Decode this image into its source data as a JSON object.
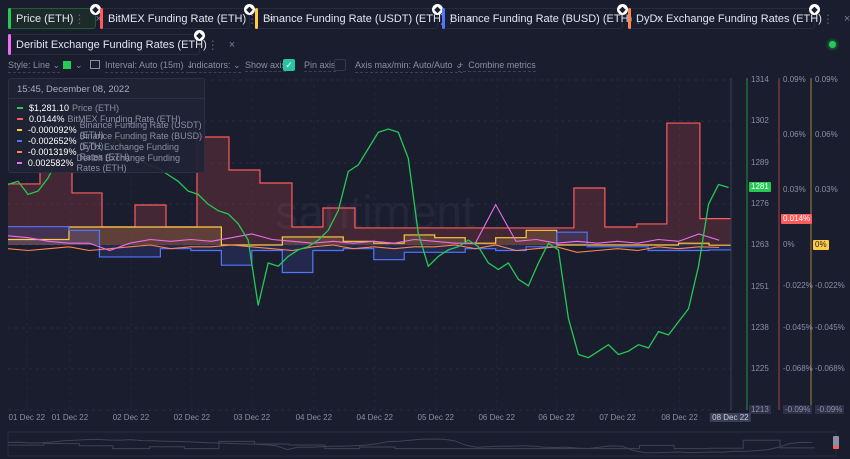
{
  "tabs": [
    {
      "label": "Price (ETH)",
      "color": "#26c953"
    },
    {
      "label": "BitMEX Funding Rate (ETH)",
      "color": "#ff5b5b"
    },
    {
      "label": "Binance Funding Rate (USDT) (ETH)",
      "color": "#ffcb47"
    },
    {
      "label": "Binance Funding Rate (BUSD) (ETH)",
      "color": "#5275ff"
    },
    {
      "label": "DyDx Exchange Funding Rates (ETH)",
      "color": "#ff8450"
    },
    {
      "label": "Deribit Exchange Funding Rates (ETH)",
      "color": "#ea6ff1"
    }
  ],
  "tab_icons": {
    "more": "⋮",
    "close": "×",
    "eth": "◆"
  },
  "toolbar": {
    "style": "Style: Line",
    "interval": "Interval: Auto (15m)",
    "indicators": "Indicators:",
    "show_axis": "Show axis",
    "show_axis_checked": true,
    "pin_axis": "Pin axis",
    "pin_axis_checked": false,
    "axis_minmax": "Axis max/min: Auto/Auto",
    "combine": "Combine metrics",
    "plus": "+",
    "chev": "⌄",
    "color": "#26c953"
  },
  "tooltip": {
    "date": "15:45, December 08, 2022",
    "rows": [
      {
        "value": "$1,281.10",
        "label": "Price (ETH)",
        "color": "#26c953"
      },
      {
        "value": "0.0144%",
        "label": "BitMEX Funding Rate (ETH)",
        "color": "#ff5b5b"
      },
      {
        "value": "-0.000092%",
        "label": "Binance Funding Rate (USDT) (ETH)",
        "color": "#ffcb47"
      },
      {
        "value": "-0.002652%",
        "label": "Binance Funding Rate (BUSD) (ETH)",
        "color": "#5275ff"
      },
      {
        "value": "-0.001319%",
        "label": "DyDx Exchange Funding Rates (ETH)",
        "color": "#ff8450"
      },
      {
        "value": "0.002582%",
        "label": "Deribit Exchange Funding Rates (ETH)",
        "color": "#ea6ff1"
      }
    ]
  },
  "watermark": "santiment",
  "chart_data": {
    "type": "line",
    "x_unit": "hours since chart start",
    "xlim": [
      0,
      142.3
    ],
    "x_ticks": [
      {
        "h": 3.7,
        "label": "01 Dec 22"
      },
      {
        "h": 12.2,
        "label": "01 Dec 22"
      },
      {
        "h": 24.2,
        "label": "02 Dec 22"
      },
      {
        "h": 36.2,
        "label": "02 Dec 22"
      },
      {
        "h": 48,
        "label": "03 Dec 22"
      },
      {
        "h": 60.2,
        "label": "04 Dec 22"
      },
      {
        "h": 72.2,
        "label": "04 Dec 22"
      },
      {
        "h": 84.2,
        "label": "05 Dec 22"
      },
      {
        "h": 96.2,
        "label": "06 Dec 22"
      },
      {
        "h": 108,
        "label": "06 Dec 22"
      },
      {
        "h": 120,
        "label": "07 Dec 22"
      },
      {
        "h": 132.2,
        "label": "08 Dec 22"
      }
    ],
    "cursor": {
      "h": 142.2,
      "label": "08 Dec 22"
    },
    "price_axis": {
      "ylim": [
        1213,
        1314
      ],
      "ticks": [
        "1314",
        "1302",
        "1289",
        "1276",
        "1263",
        "1251",
        "1238",
        "1225",
        "1213"
      ],
      "current": "1281"
    },
    "funding_axis": {
      "ylim": [
        -0.09,
        0.09
      ],
      "ticks": [
        {
          "v": 0.09,
          "label": "0.09%"
        },
        {
          "v": 0.06,
          "label": "0.06%"
        },
        {
          "v": 0.03,
          "label": "0.03%"
        },
        {
          "v": 0,
          "label": "0%"
        },
        {
          "v": -0.0225,
          "label": "-0.022%"
        },
        {
          "v": -0.045,
          "label": "-0.045%"
        },
        {
          "v": -0.0675,
          "label": "-0.068%"
        },
        {
          "v": -0.09,
          "label": "-0.09%"
        }
      ],
      "bitmex_current": "0.014%",
      "binance_current": "0%"
    },
    "series": [
      {
        "name": "Price (ETH)",
        "color": "#26c953",
        "interval_h": 1.97,
        "values": [
          1282,
          1283,
          1279,
          1280,
          1284,
          1290,
          1293,
          1296,
          1297,
          1294,
          1293,
          1296,
          1291,
          1290,
          1288,
          1287,
          1285,
          1283,
          1280,
          1279,
          1276,
          1274,
          1273,
          1270,
          1265,
          1245,
          1258,
          1257,
          1260,
          1262,
          1263,
          1265,
          1268,
          1274,
          1286,
          1288,
          1293,
          1298,
          1299,
          1298,
          1290,
          1267,
          1257,
          1260,
          1262,
          1263,
          1265,
          1263,
          1258,
          1256,
          1258,
          1253,
          1251,
          1258,
          1264,
          1262,
          1241,
          1230,
          1229,
          1231,
          1233,
          1230,
          1231,
          1233,
          1232,
          1237,
          1236,
          1240,
          1244,
          1257,
          1276,
          1282,
          1281.1
        ]
      },
      {
        "name": "BitMEX Funding Rate (ETH)",
        "color": "#ff5b5b",
        "steps": [
          [
            0,
            0.0333
          ],
          [
            6.3,
            0.0436
          ],
          [
            12.6,
            0.0284
          ],
          [
            18.5,
            0.0098
          ],
          [
            25,
            0.0218
          ],
          [
            31.1,
            0.0098
          ],
          [
            37.2,
            0.0589
          ],
          [
            43.5,
            0.0409
          ],
          [
            49.6,
            0.0338
          ],
          [
            55.9,
            0.0098
          ],
          [
            62,
            0.0202
          ],
          [
            68.3,
            0.0093
          ],
          [
            111.4,
            0.0311
          ],
          [
            117.5,
            0.0098
          ],
          [
            123.8,
            0.0115
          ],
          [
            129.7,
            0.0665
          ],
          [
            136.2,
            0.0144
          ]
        ]
      },
      {
        "name": "Binance Funding Rate (USDT) (ETH)",
        "color": "#ffcb47",
        "interval_h": 6,
        "values": [
          0.003,
          0.003,
          0.0098,
          0.0098,
          0.0098,
          0.0098,
          0.0098,
          0.0,
          0.0,
          0.0044,
          0.0044,
          0.002,
          0.001,
          0.0055,
          0.004,
          0.001,
          0.004,
          0.008,
          0.0,
          0.0,
          0.0,
          0.0,
          0.001,
          -0.0001
        ]
      },
      {
        "name": "Binance Funding Rate (BUSD) (ETH)",
        "color": "#5275ff",
        "interval_h": 6,
        "values": [
          0.01,
          0.01,
          0.008,
          -0.0065,
          -0.0065,
          -0.002,
          -0.003,
          -0.011,
          -0.003,
          -0.015,
          -0.003,
          -0.002,
          -0.008,
          -0.004,
          -0.004,
          -0.002,
          -0.003,
          -0.001,
          0.007,
          -0.001,
          -0.001,
          -0.003,
          -0.003,
          -0.0027
        ]
      },
      {
        "name": "DyDx Exchange Funding Rates (ETH)",
        "color": "#ff8450",
        "interval_h": 4,
        "values": [
          -0.002,
          -0.003,
          -0.002,
          -0.001,
          -0.003,
          -0.002,
          -0.001,
          0.0,
          -0.002,
          -0.001,
          -0.001,
          0.0,
          -0.001,
          -0.002,
          -0.003,
          -0.001,
          0.0,
          -0.002,
          -0.001,
          -0.002,
          -0.001,
          -0.001,
          0.0,
          -0.002,
          0.0,
          -0.003,
          -0.002,
          -0.001,
          -0.004,
          -0.003,
          -0.002,
          -0.003,
          -0.001,
          -0.002,
          -0.001,
          -0.0013
        ]
      },
      {
        "name": "Deribit Exchange Funding Rates (ETH)",
        "color": "#ea6ff1",
        "interval_h": 4,
        "values": [
          0.005,
          0.004,
          0.002,
          0.001,
          0.001,
          -0.003,
          0.001,
          0.003,
          0.002,
          0.003,
          0.002,
          0.004,
          0.006,
          0.003,
          0.002,
          0.001,
          0.002,
          0.001,
          0.002,
          0.001,
          0.003,
          0.002,
          0.001,
          0.001,
          0.022,
          0.002,
          0.003,
          0.001,
          0.002,
          0.001,
          0.002,
          0.001,
          0.003,
          0.002,
          0.006,
          0.0026
        ]
      }
    ]
  }
}
